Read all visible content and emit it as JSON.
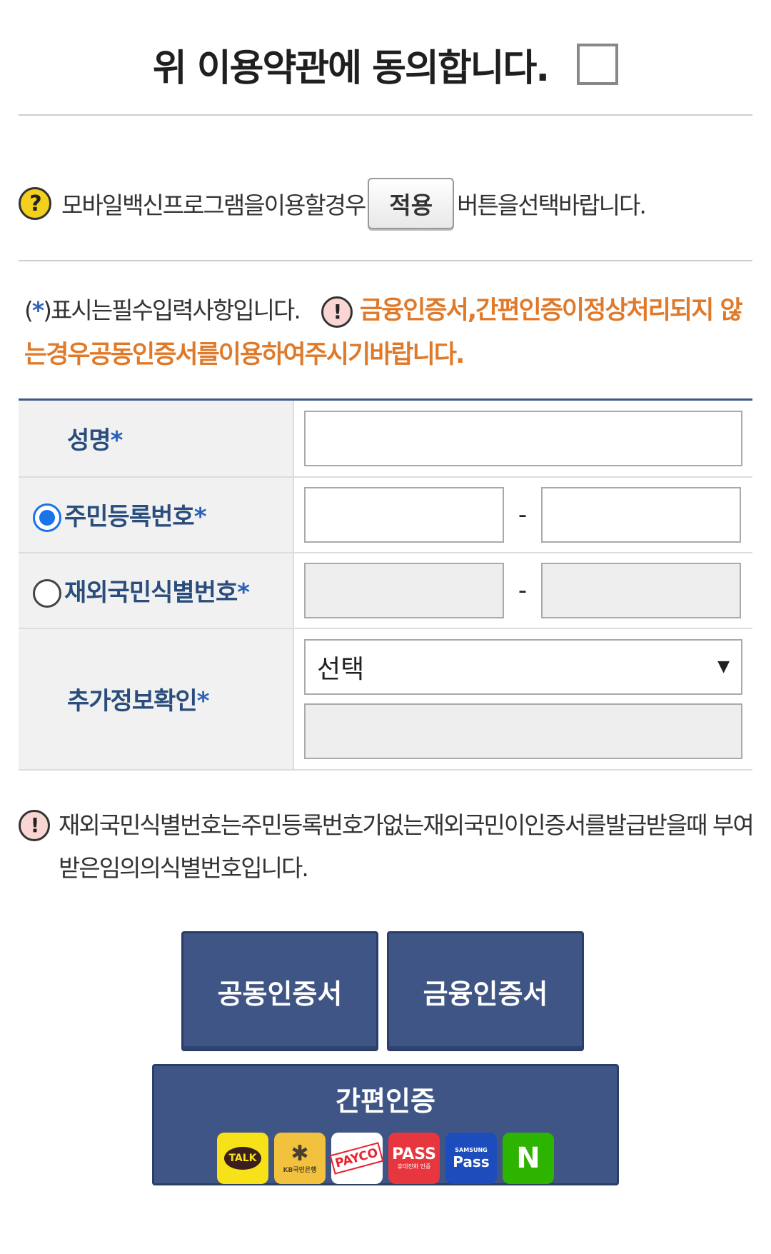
{
  "agree": {
    "text": "위 이용약관에 동의합니다."
  },
  "vaccine": {
    "prefix": "모바일백신프로그램을이용할경우",
    "button": "적용",
    "suffix": "버튼을선택바랍니다."
  },
  "notice": {
    "required_paren_open": "(",
    "required_star": "*",
    "required_text": ")표시는필수입력사항입니다.",
    "warning": "금융인증서,간편인증이정상처리되지 않는경우공동인증서를이용하여주시기바랍니다."
  },
  "form": {
    "name_label": "성명",
    "rrn_label": "주민등록번호",
    "foreign_label": "재외국민식별번호",
    "extra_label": "추가정보확인",
    "star": "*",
    "dash": "-",
    "select_value": "선택",
    "select_arrow": "▼"
  },
  "bottom_note": {
    "text": "재외국민식별번호는주민등록번호가없는재외국민이인증서를발급받을때 부여받은임의의식별번호입니다."
  },
  "buttons": {
    "joint_cert": "공동인증서",
    "financial_cert": "금융인증서",
    "simple_auth": "간편인증"
  },
  "simple_icons": {
    "talk": "TALK",
    "kb": "KB국민은행",
    "payco": "PAYCO",
    "pass": "PASS",
    "pass_sub": "휴대전화 인증",
    "samsung_top": "SAMSUNG",
    "samsung_pass": "Pass",
    "naver": "N"
  },
  "icons": {
    "help": "question-circle-icon",
    "warning": "exclamation-circle-icon"
  },
  "colors": {
    "navy_button": "#3f5585",
    "label_text": "#2a4d7c",
    "warning_orange": "#e07a2b",
    "radio_blue": "#1a73e8"
  }
}
